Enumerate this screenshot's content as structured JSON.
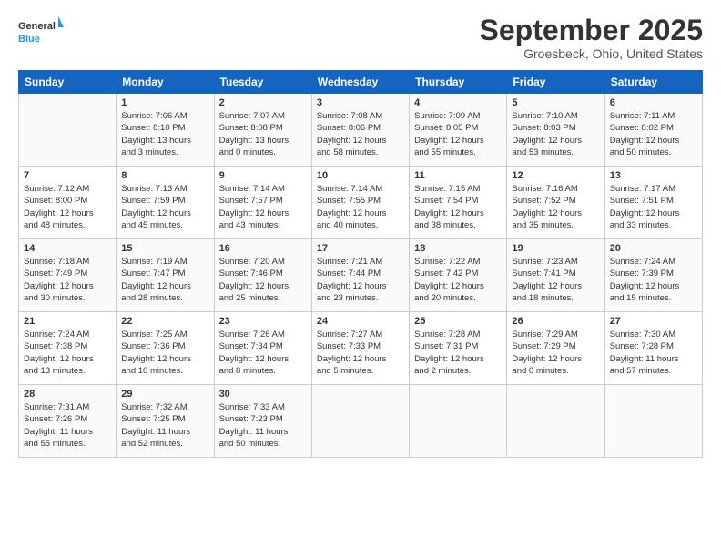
{
  "header": {
    "logo_general": "General",
    "logo_blue": "Blue",
    "month_title": "September 2025",
    "location": "Groesbeck, Ohio, United States"
  },
  "days_of_week": [
    "Sunday",
    "Monday",
    "Tuesday",
    "Wednesday",
    "Thursday",
    "Friday",
    "Saturday"
  ],
  "weeks": [
    [
      {
        "day": "",
        "info": ""
      },
      {
        "day": "1",
        "info": "Sunrise: 7:06 AM\nSunset: 8:10 PM\nDaylight: 13 hours\nand 3 minutes."
      },
      {
        "day": "2",
        "info": "Sunrise: 7:07 AM\nSunset: 8:08 PM\nDaylight: 13 hours\nand 0 minutes."
      },
      {
        "day": "3",
        "info": "Sunrise: 7:08 AM\nSunset: 8:06 PM\nDaylight: 12 hours\nand 58 minutes."
      },
      {
        "day": "4",
        "info": "Sunrise: 7:09 AM\nSunset: 8:05 PM\nDaylight: 12 hours\nand 55 minutes."
      },
      {
        "day": "5",
        "info": "Sunrise: 7:10 AM\nSunset: 8:03 PM\nDaylight: 12 hours\nand 53 minutes."
      },
      {
        "day": "6",
        "info": "Sunrise: 7:11 AM\nSunset: 8:02 PM\nDaylight: 12 hours\nand 50 minutes."
      }
    ],
    [
      {
        "day": "7",
        "info": "Sunrise: 7:12 AM\nSunset: 8:00 PM\nDaylight: 12 hours\nand 48 minutes."
      },
      {
        "day": "8",
        "info": "Sunrise: 7:13 AM\nSunset: 7:59 PM\nDaylight: 12 hours\nand 45 minutes."
      },
      {
        "day": "9",
        "info": "Sunrise: 7:14 AM\nSunset: 7:57 PM\nDaylight: 12 hours\nand 43 minutes."
      },
      {
        "day": "10",
        "info": "Sunrise: 7:14 AM\nSunset: 7:55 PM\nDaylight: 12 hours\nand 40 minutes."
      },
      {
        "day": "11",
        "info": "Sunrise: 7:15 AM\nSunset: 7:54 PM\nDaylight: 12 hours\nand 38 minutes."
      },
      {
        "day": "12",
        "info": "Sunrise: 7:16 AM\nSunset: 7:52 PM\nDaylight: 12 hours\nand 35 minutes."
      },
      {
        "day": "13",
        "info": "Sunrise: 7:17 AM\nSunset: 7:51 PM\nDaylight: 12 hours\nand 33 minutes."
      }
    ],
    [
      {
        "day": "14",
        "info": "Sunrise: 7:18 AM\nSunset: 7:49 PM\nDaylight: 12 hours\nand 30 minutes."
      },
      {
        "day": "15",
        "info": "Sunrise: 7:19 AM\nSunset: 7:47 PM\nDaylight: 12 hours\nand 28 minutes."
      },
      {
        "day": "16",
        "info": "Sunrise: 7:20 AM\nSunset: 7:46 PM\nDaylight: 12 hours\nand 25 minutes."
      },
      {
        "day": "17",
        "info": "Sunrise: 7:21 AM\nSunset: 7:44 PM\nDaylight: 12 hours\nand 23 minutes."
      },
      {
        "day": "18",
        "info": "Sunrise: 7:22 AM\nSunset: 7:42 PM\nDaylight: 12 hours\nand 20 minutes."
      },
      {
        "day": "19",
        "info": "Sunrise: 7:23 AM\nSunset: 7:41 PM\nDaylight: 12 hours\nand 18 minutes."
      },
      {
        "day": "20",
        "info": "Sunrise: 7:24 AM\nSunset: 7:39 PM\nDaylight: 12 hours\nand 15 minutes."
      }
    ],
    [
      {
        "day": "21",
        "info": "Sunrise: 7:24 AM\nSunset: 7:38 PM\nDaylight: 12 hours\nand 13 minutes."
      },
      {
        "day": "22",
        "info": "Sunrise: 7:25 AM\nSunset: 7:36 PM\nDaylight: 12 hours\nand 10 minutes."
      },
      {
        "day": "23",
        "info": "Sunrise: 7:26 AM\nSunset: 7:34 PM\nDaylight: 12 hours\nand 8 minutes."
      },
      {
        "day": "24",
        "info": "Sunrise: 7:27 AM\nSunset: 7:33 PM\nDaylight: 12 hours\nand 5 minutes."
      },
      {
        "day": "25",
        "info": "Sunrise: 7:28 AM\nSunset: 7:31 PM\nDaylight: 12 hours\nand 2 minutes."
      },
      {
        "day": "26",
        "info": "Sunrise: 7:29 AM\nSunset: 7:29 PM\nDaylight: 12 hours\nand 0 minutes."
      },
      {
        "day": "27",
        "info": "Sunrise: 7:30 AM\nSunset: 7:28 PM\nDaylight: 11 hours\nand 57 minutes."
      }
    ],
    [
      {
        "day": "28",
        "info": "Sunrise: 7:31 AM\nSunset: 7:26 PM\nDaylight: 11 hours\nand 55 minutes."
      },
      {
        "day": "29",
        "info": "Sunrise: 7:32 AM\nSunset: 7:25 PM\nDaylight: 11 hours\nand 52 minutes."
      },
      {
        "day": "30",
        "info": "Sunrise: 7:33 AM\nSunset: 7:23 PM\nDaylight: 11 hours\nand 50 minutes."
      },
      {
        "day": "",
        "info": ""
      },
      {
        "day": "",
        "info": ""
      },
      {
        "day": "",
        "info": ""
      },
      {
        "day": "",
        "info": ""
      }
    ]
  ]
}
